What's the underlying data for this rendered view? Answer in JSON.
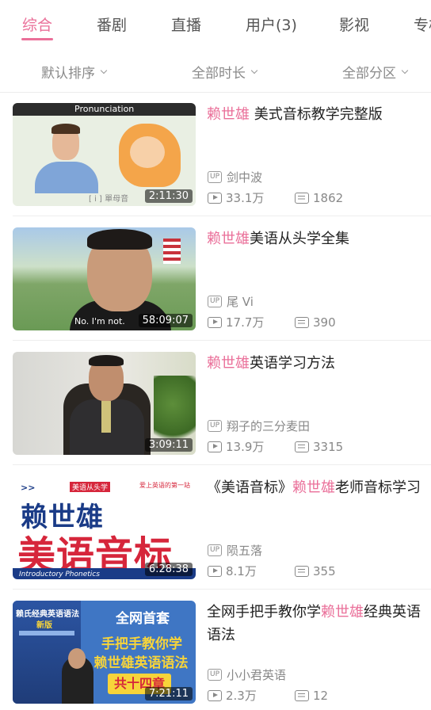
{
  "tabs": [
    {
      "label": "综合",
      "active": true
    },
    {
      "label": "番剧"
    },
    {
      "label": "直播"
    },
    {
      "label": "用户(3)"
    },
    {
      "label": "影视"
    },
    {
      "label": "专栏"
    }
  ],
  "filters": {
    "sort": "默认排序",
    "duration": "全部时长",
    "category": "全部分区"
  },
  "accent_color": "#ea6f99",
  "videos": [
    {
      "title_before": "",
      "title_highlight": "赖世雄",
      "title_after": " 美式音标教学完整版",
      "duration": "2:11:30",
      "uploader": "剑中波",
      "views": "33.1万",
      "danmaku": "1862",
      "thumb_text": "Pronunciation",
      "thumb_caption": "[ i ] 單母音"
    },
    {
      "title_before": "",
      "title_highlight": "赖世雄",
      "title_after": "美语从头学全集",
      "duration": "58:09:07",
      "uploader": "尾 Vi",
      "views": "17.7万",
      "danmaku": "390",
      "thumb_sub": "No. I'm not."
    },
    {
      "title_before": "",
      "title_highlight": "赖世雄",
      "title_after": "英语学习方法",
      "duration": "3:09:11",
      "uploader": "翔子的三分麦田",
      "views": "13.9万",
      "danmaku": "3315"
    },
    {
      "title_before": "《美语音标》",
      "title_highlight": "赖世雄",
      "title_after": "老师音标学习",
      "duration": "6:28:38",
      "uploader": "陨五落",
      "views": "8.1万",
      "danmaku": "355",
      "thumb_top": "美语从头学",
      "thumb_big1": "赖世雄",
      "thumb_big2": "美语音标",
      "thumb_band": "Introductory Phonetics",
      "thumb_site": "爱上英语的第一站"
    },
    {
      "title_before": "全网手把手教你学",
      "title_highlight": "赖世雄",
      "title_after": "经典英语语法",
      "duration": "7:21:11",
      "uploader": "小小君英语",
      "views": "2.3万",
      "danmaku": "12",
      "thumb_l1": "全网首套",
      "thumb_l2": "手把手教你学",
      "thumb_l3": "赖世雄英语语法",
      "thumb_l4": "共十四章",
      "thumb_book": "赖氏经典英语语法",
      "thumb_book_new": "新版"
    }
  ]
}
